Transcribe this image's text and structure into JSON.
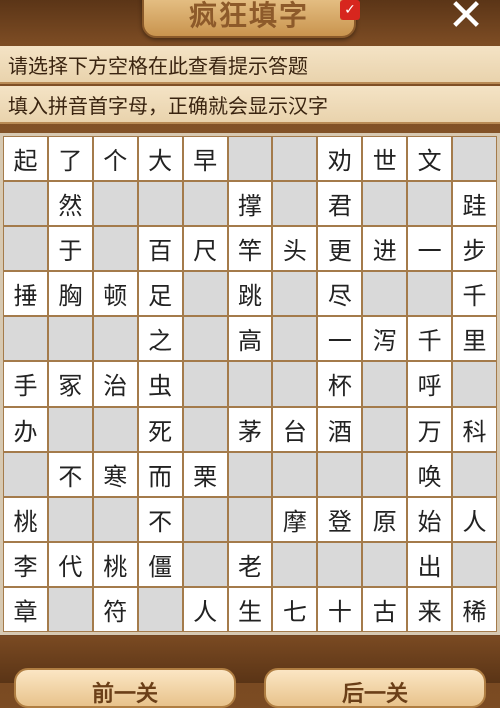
{
  "header": {
    "title": "疯狂填字",
    "badge_icon": "✓",
    "close_icon": "✕"
  },
  "hints": {
    "line1": "请选择下方空格在此查看提示答题",
    "line2": "填入拼音首字母，正确就会显示汉字"
  },
  "grid": {
    "rows": [
      [
        "起",
        "了",
        "个",
        "大",
        "早",
        "",
        "",
        "劝",
        "世",
        "文",
        ""
      ],
      [
        "",
        "然",
        "",
        "",
        "",
        "撑",
        "",
        "君",
        "",
        "",
        "跬"
      ],
      [
        "",
        "于",
        "",
        "百",
        "尺",
        "竿",
        "头",
        "更",
        "进",
        "一",
        "步"
      ],
      [
        "捶",
        "胸",
        "顿",
        "足",
        "",
        "跳",
        "",
        "尽",
        "",
        "",
        "千"
      ],
      [
        "",
        "",
        "",
        "之",
        "",
        "高",
        "",
        "一",
        "泻",
        "千",
        "里"
      ],
      [
        "手",
        "冢",
        "治",
        "虫",
        "",
        "",
        "",
        "杯",
        "",
        "呼",
        ""
      ],
      [
        "办",
        "",
        "",
        "死",
        "",
        "茅",
        "台",
        "酒",
        "",
        "万",
        "科"
      ],
      [
        "",
        "不",
        "寒",
        "而",
        "栗",
        "",
        "",
        "",
        "",
        "唤",
        ""
      ],
      [
        "桃",
        "",
        "",
        "不",
        "",
        "",
        "摩",
        "登",
        "原",
        "始",
        "人"
      ],
      [
        "李",
        "代",
        "桃",
        "僵",
        "",
        "老",
        "",
        "",
        "",
        "出",
        ""
      ],
      [
        "章",
        "",
        "符",
        "",
        "人",
        "生",
        "七",
        "十",
        "古",
        "来",
        "稀"
      ]
    ]
  },
  "nav": {
    "prev_label": "前一关",
    "next_label": "后一关"
  }
}
